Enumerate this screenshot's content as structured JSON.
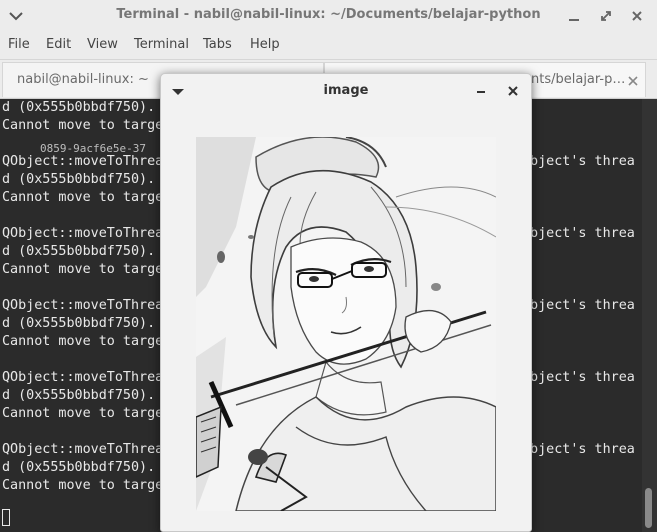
{
  "window": {
    "title": "Terminal - nabil@nabil-linux: ~/Documents/belajar-python"
  },
  "menubar": {
    "items": [
      "File",
      "Edit",
      "View",
      "Terminal",
      "Tabs",
      "Help"
    ]
  },
  "tabs": [
    {
      "label": "nabil@nabil-linux: ~"
    },
    {
      "label": "nabil@nabil-linux: ~/Documents/belajar-python"
    }
  ],
  "tab2_visible": "nts/belajar-p…",
  "terminal": {
    "left": [
      "d (0x555b0bbdf750).",
      "Cannot move to targe",
      "",
      "QObject::moveToThrea",
      "d (0x555b0bbdf750).",
      "Cannot move to targe",
      "",
      "QObject::moveToThrea",
      "d (0x555b0bbdf750).",
      "Cannot move to targe",
      "",
      "QObject::moveToThrea",
      "d (0x555b0bbdf750).",
      "Cannot move to targe",
      "",
      "QObject::moveToThrea",
      "d (0x555b0bbdf750).",
      "Cannot move to targe",
      "",
      "QObject::moveToThrea",
      "d (0x555b0bbdf750).",
      "Cannot move to targe"
    ],
    "right": [
      "",
      "",
      "",
      "object's threa",
      "",
      "",
      "",
      "object's threa",
      "",
      "",
      "",
      "object's threa",
      "",
      "",
      "",
      "object's threa",
      "",
      "",
      "",
      "object's threa",
      "",
      ""
    ],
    "ghost": "0859-9acf6e5e-37"
  },
  "image_window": {
    "title": "image"
  },
  "colors": {
    "terminal_bg": "#2b2b2b",
    "terminal_fg": "#e8e8e8",
    "chrome_bg": "#ececec"
  }
}
